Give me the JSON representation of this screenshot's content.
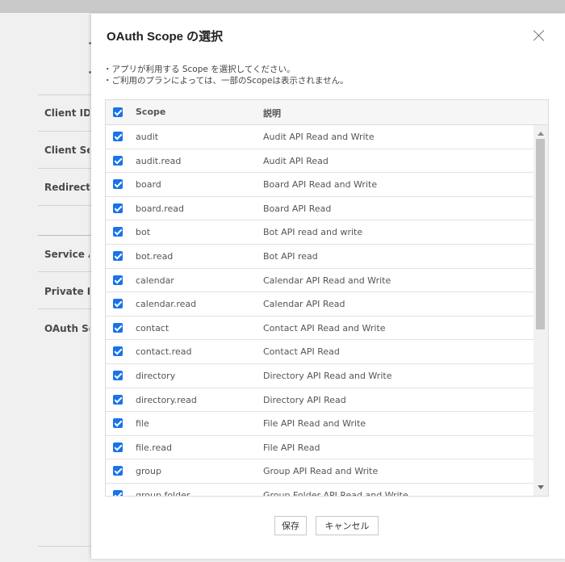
{
  "background": {
    "labels": [
      "Client ID",
      "Client Secret",
      "Redirect URL",
      "Service Account",
      "Private Key",
      "OAuth Scopes"
    ]
  },
  "modal": {
    "title": "OAuth Scope の選択",
    "notes": [
      "・アプリが利用する Scope を選択してください。",
      "・ご利用のプランによっては、一部のScopeは表示されません。"
    ],
    "table": {
      "header": {
        "scope": "Scope",
        "description": "説明",
        "all_checked": true
      },
      "rows": [
        {
          "scope": "audit",
          "description": "Audit API Read and Write",
          "checked": true
        },
        {
          "scope": "audit.read",
          "description": "Audit API Read",
          "checked": true
        },
        {
          "scope": "board",
          "description": "Board API Read and Write",
          "checked": true
        },
        {
          "scope": "board.read",
          "description": "Board API Read",
          "checked": true
        },
        {
          "scope": "bot",
          "description": "Bot API read and write",
          "checked": true
        },
        {
          "scope": "bot.read",
          "description": "Bot API read",
          "checked": true
        },
        {
          "scope": "calendar",
          "description": "Calendar API Read and Write",
          "checked": true
        },
        {
          "scope": "calendar.read",
          "description": "Calendar API Read",
          "checked": true
        },
        {
          "scope": "contact",
          "description": "Contact API Read and Write",
          "checked": true
        },
        {
          "scope": "contact.read",
          "description": "Contact API Read",
          "checked": true
        },
        {
          "scope": "directory",
          "description": "Directory API Read and Write",
          "checked": true
        },
        {
          "scope": "directory.read",
          "description": "Directory API Read",
          "checked": true
        },
        {
          "scope": "file",
          "description": "File API Read and Write",
          "checked": true
        },
        {
          "scope": "file.read",
          "description": "File API Read",
          "checked": true
        },
        {
          "scope": "group",
          "description": "Group API Read and Write",
          "checked": true
        },
        {
          "scope": "group.folder",
          "description": "Group Folder API Read and Write",
          "checked": true
        }
      ]
    },
    "buttons": {
      "save": "保存",
      "cancel": "キャンセル"
    }
  },
  "colors": {
    "accent": "#1a73e8"
  }
}
